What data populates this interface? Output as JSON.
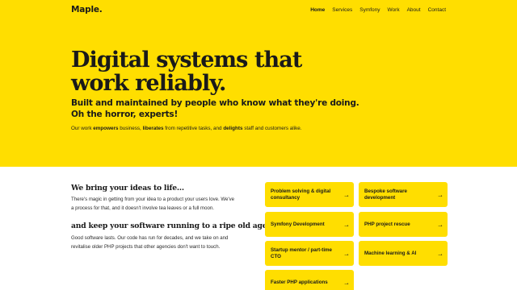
{
  "brand": {
    "name": "Maple.",
    "accent": "#ffde00"
  },
  "nav": {
    "items": [
      {
        "label": "Home",
        "active": true
      },
      {
        "label": "Services",
        "active": false
      },
      {
        "label": "Symfony",
        "active": false
      },
      {
        "label": "Work",
        "active": false
      },
      {
        "label": "About",
        "active": false
      },
      {
        "label": "Contact",
        "active": false
      }
    ]
  },
  "hero": {
    "headline_line1": "Digital systems that",
    "headline_line2": "work reliably.",
    "subhead_line1": "Built and maintained by people who know what they're doing.",
    "subhead_line2": "Oh the horror, experts!",
    "intro": {
      "t1": "Our work ",
      "b1": "empowers",
      "t2": " business, ",
      "b2": "liberates",
      "t3": " from repetitive tasks, and ",
      "b3": "delights",
      "t4": " staff and customers alike."
    }
  },
  "section_ideas": {
    "title": "We bring your ideas to life...",
    "line1": "There's magic in getting from your idea to a product your users love. We've",
    "line2": "a process for that, and it doesn't involve tea leaves or a full moon."
  },
  "section_maintain": {
    "title": "and keep your software running to a ripe old age",
    "line1": "Good software lasts. Our code has run for decades, and we take on and",
    "line2": "revitalise older PHP projects that other agencies don't want to touch."
  },
  "services": [
    {
      "label": "Problem solving & digital consultancy"
    },
    {
      "label": "Bespoke software development"
    },
    {
      "label": "Symfony Development"
    },
    {
      "label": "PHP project rescue"
    },
    {
      "label": "Startup mentor / part-time CTO"
    },
    {
      "label": "Machine learning & AI"
    },
    {
      "label": "Faster PHP applications"
    }
  ],
  "icons": {
    "card_arrow": "arrow-right-icon",
    "arrow_glyph": "→"
  }
}
